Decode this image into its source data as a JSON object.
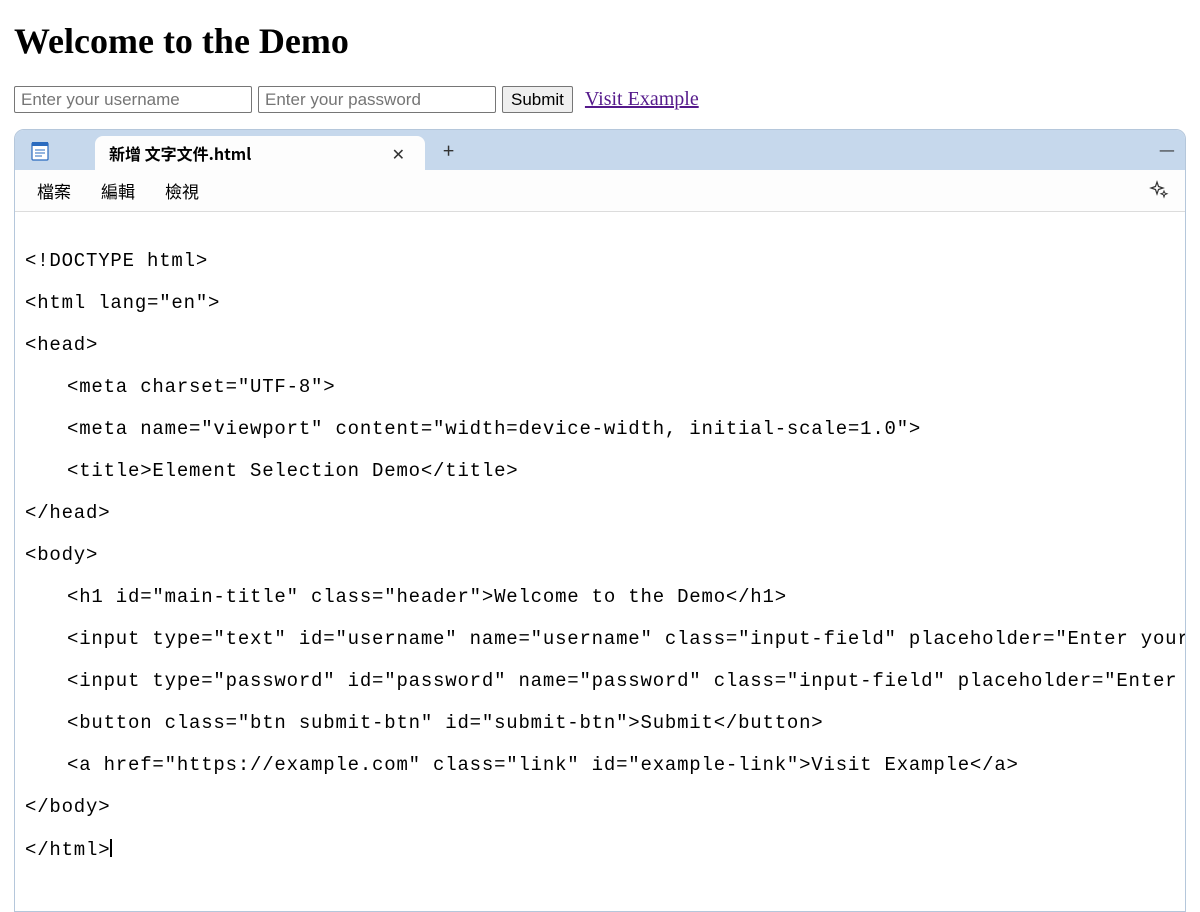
{
  "demo": {
    "heading": "Welcome to the Demo",
    "username_placeholder": "Enter your username",
    "password_placeholder": "Enter your password",
    "submit_label": "Submit",
    "link_label": "Visit Example"
  },
  "editor": {
    "tab_title": "新增 文字文件.html",
    "menus": {
      "file": "檔案",
      "edit": "編輯",
      "view": "檢視"
    },
    "code": {
      "l1": "<!DOCTYPE html>",
      "l2": "<html lang=\"en\">",
      "l3": "<head>",
      "l4": "<meta charset=\"UTF-8\">",
      "l5": "<meta name=\"viewport\" content=\"width=device-width, initial-scale=1.0\">",
      "l6": "<title>Element Selection Demo</title>",
      "l7": "</head>",
      "l8": "<body>",
      "l9": "<h1 id=\"main-title\" class=\"header\">Welcome to the Demo</h1>",
      "l10": "<input type=\"text\" id=\"username\" name=\"username\" class=\"input-field\" placeholder=\"Enter your username\">",
      "l11": "<input type=\"password\" id=\"password\" name=\"password\" class=\"input-field\" placeholder=\"Enter your password\">",
      "l12": "<button class=\"btn submit-btn\" id=\"submit-btn\">Submit</button>",
      "l13": "<a href=\"https://example.com\" class=\"link\" id=\"example-link\">Visit Example</a>",
      "l14": "</body>",
      "l15": "</html>"
    }
  }
}
